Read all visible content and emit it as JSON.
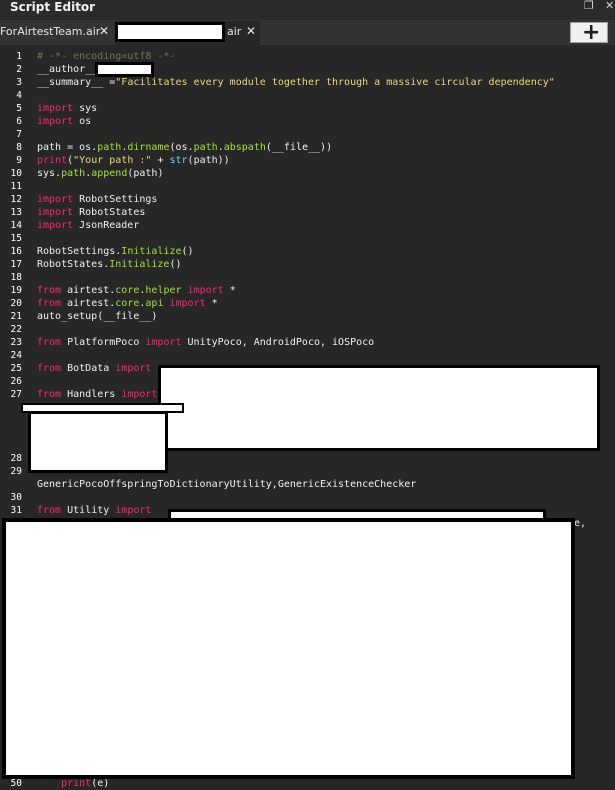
{
  "window": {
    "title": "Script Editor",
    "restore_glyph": "❐",
    "close_glyph": "✕"
  },
  "tabs": [
    {
      "label": "ForAirtestTeam.air",
      "close": "✕"
    },
    {
      "label": "air",
      "close": "✕"
    }
  ],
  "add_button": "+",
  "code_lines": [
    {
      "n": "1",
      "t": "# -*- encoding=utf8 -*-"
    },
    {
      "n": "2",
      "t": "__author__ = "
    },
    {
      "n": "3",
      "t": "__summary__ =\"Facilitates every module together through a massive circular dependency\""
    },
    {
      "n": "4",
      "t": ""
    },
    {
      "n": "5",
      "t": "import sys"
    },
    {
      "n": "6",
      "t": "import os"
    },
    {
      "n": "7",
      "t": ""
    },
    {
      "n": "8",
      "t": "path = os.path.dirname(os.path.abspath(__file__))"
    },
    {
      "n": "9",
      "t": "print(\"Your path :\" + str(path))"
    },
    {
      "n": "10",
      "t": "sys.path.append(path)"
    },
    {
      "n": "11",
      "t": ""
    },
    {
      "n": "12",
      "t": "import RobotSettings"
    },
    {
      "n": "13",
      "t": "import RobotStates"
    },
    {
      "n": "14",
      "t": "import JsonReader"
    },
    {
      "n": "15",
      "t": ""
    },
    {
      "n": "16",
      "t": "RobotSettings.Initialize()"
    },
    {
      "n": "17",
      "t": "RobotStates.Initialize()"
    },
    {
      "n": "18",
      "t": ""
    },
    {
      "n": "19",
      "t": "from airtest.core.helper import *"
    },
    {
      "n": "20",
      "t": "from airtest.core.api import *"
    },
    {
      "n": "21",
      "t": "auto_setup(__file__)"
    },
    {
      "n": "22",
      "t": ""
    },
    {
      "n": "23",
      "t": "from PlatformPoco import UnityPoco, AndroidPoco, iOSPoco"
    },
    {
      "n": "24",
      "t": ""
    },
    {
      "n": "25",
      "t": "from BotData import"
    },
    {
      "n": "26",
      "t": ""
    },
    {
      "n": "27",
      "t": "from Handlers import"
    },
    {
      "n": "28",
      "t": ""
    },
    {
      "n": "29",
      "t": ""
    },
    {
      "n": "",
      "t": "GenericPocoOffspringToDictionaryUtility,GenericExistenceChecker"
    },
    {
      "n": "30",
      "t": ""
    },
    {
      "n": "31",
      "t": "from Utility import"
    },
    {
      "n": "",
      "t": "e,"
    },
    {
      "n": "50",
      "t": "    print(e)"
    }
  ]
}
